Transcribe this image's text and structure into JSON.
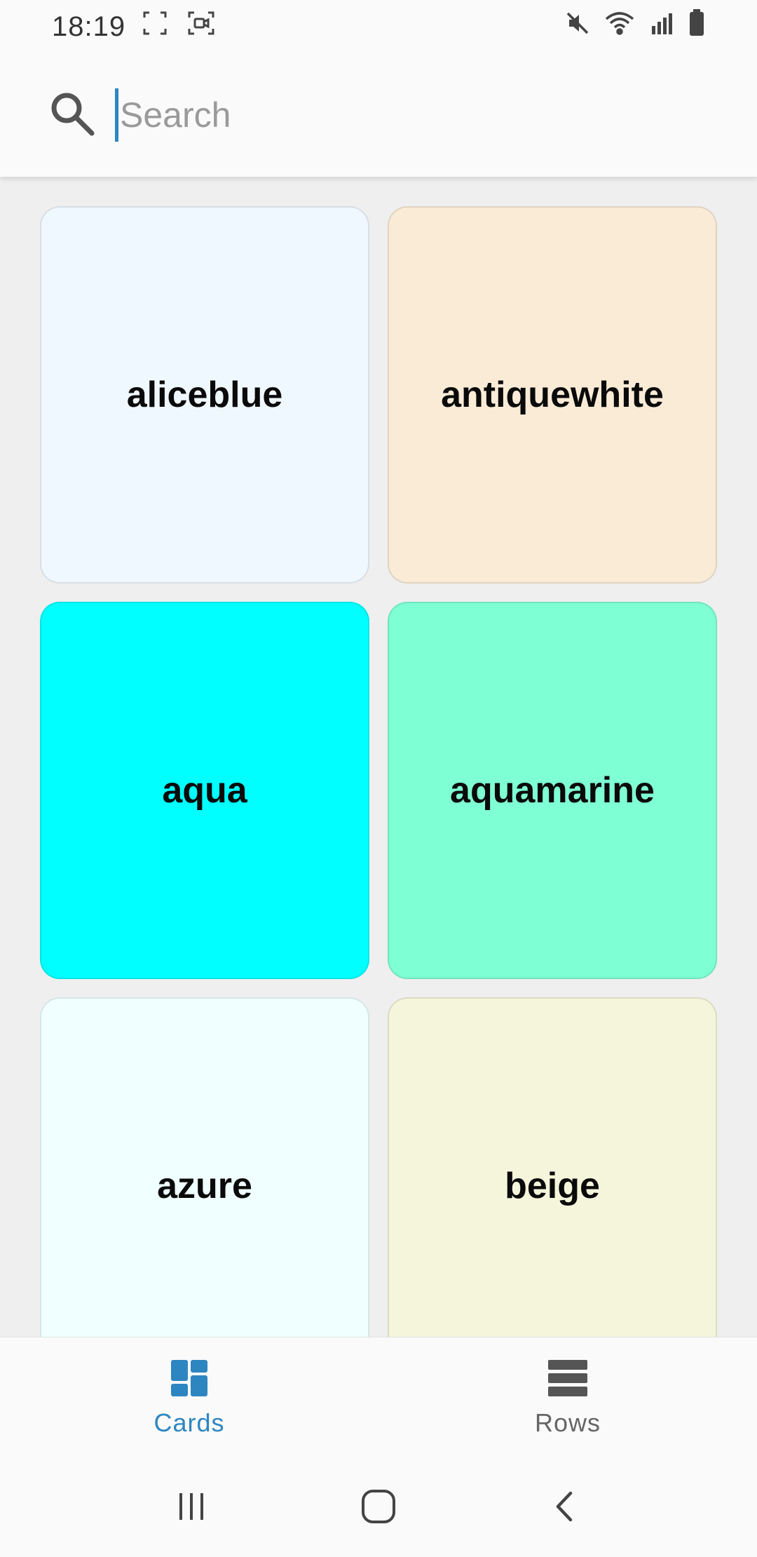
{
  "status_bar": {
    "time": "18:19",
    "icons": [
      "screenshot-frame-icon",
      "screen-record-icon",
      "mute-icon",
      "wifi-icon",
      "signal-icon",
      "battery-icon"
    ]
  },
  "search": {
    "placeholder": "Search",
    "value": ""
  },
  "cards": [
    {
      "label": "aliceblue",
      "color": "#F0F8FF"
    },
    {
      "label": "antiquewhite",
      "color": "#FAEBD7"
    },
    {
      "label": "aqua",
      "color": "#00FFFF"
    },
    {
      "label": "aquamarine",
      "color": "#7FFFD4"
    },
    {
      "label": "azure",
      "color": "#F0FFFF"
    },
    {
      "label": "beige",
      "color": "#F5F5DC"
    }
  ],
  "bottom_nav": {
    "tabs": [
      {
        "label": "Cards",
        "icon": "dashboard-grid-icon",
        "active": true
      },
      {
        "label": "Rows",
        "icon": "rows-list-icon",
        "active": false
      }
    ]
  },
  "colors": {
    "accent": "#2E86C1",
    "inactive": "#666666",
    "background": "#EFEFEF",
    "surface": "#FAFAFA"
  }
}
